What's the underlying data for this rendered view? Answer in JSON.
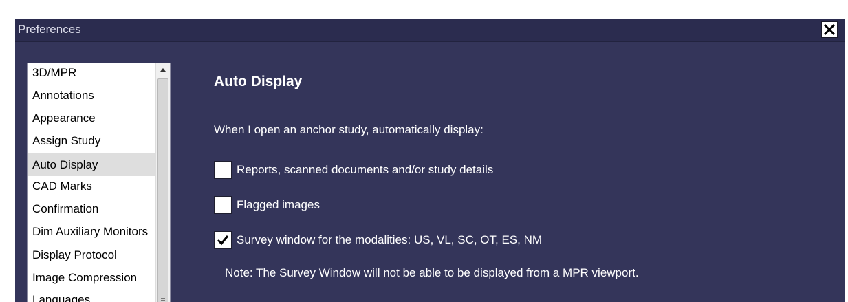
{
  "window": {
    "title": "Preferences"
  },
  "sidebar": {
    "items": [
      {
        "label": "3D/MPR"
      },
      {
        "label": "Annotations"
      },
      {
        "label": "Appearance"
      },
      {
        "label": "Assign Study"
      },
      {
        "label": "Auto Display"
      },
      {
        "label": "CAD Marks"
      },
      {
        "label": "Confirmation"
      },
      {
        "label": "Dim Auxiliary Monitors"
      },
      {
        "label": "Display Protocol"
      },
      {
        "label": "Image Compression"
      },
      {
        "label": "Languages"
      }
    ],
    "selected": "Auto Display"
  },
  "main": {
    "heading": "Auto Display",
    "intro": "When I open an anchor study, automatically display:",
    "options": [
      {
        "label": "Reports, scanned documents and/or study details",
        "checked": false
      },
      {
        "label": "Flagged images",
        "checked": false
      },
      {
        "label": "Survey window for the modalities: US, VL, SC, OT, ES, NM",
        "checked": true
      }
    ],
    "note": "Note: The Survey Window will not be able to be displayed from a MPR viewport."
  },
  "colors": {
    "panel_background": "#34355a",
    "titlebar_background": "#2b2c4f",
    "selected_item": "#dedede"
  },
  "icons": {
    "close": "close-icon",
    "scroll_up": "scroll-up-arrow-icon",
    "checkmark": "checkmark-icon"
  }
}
